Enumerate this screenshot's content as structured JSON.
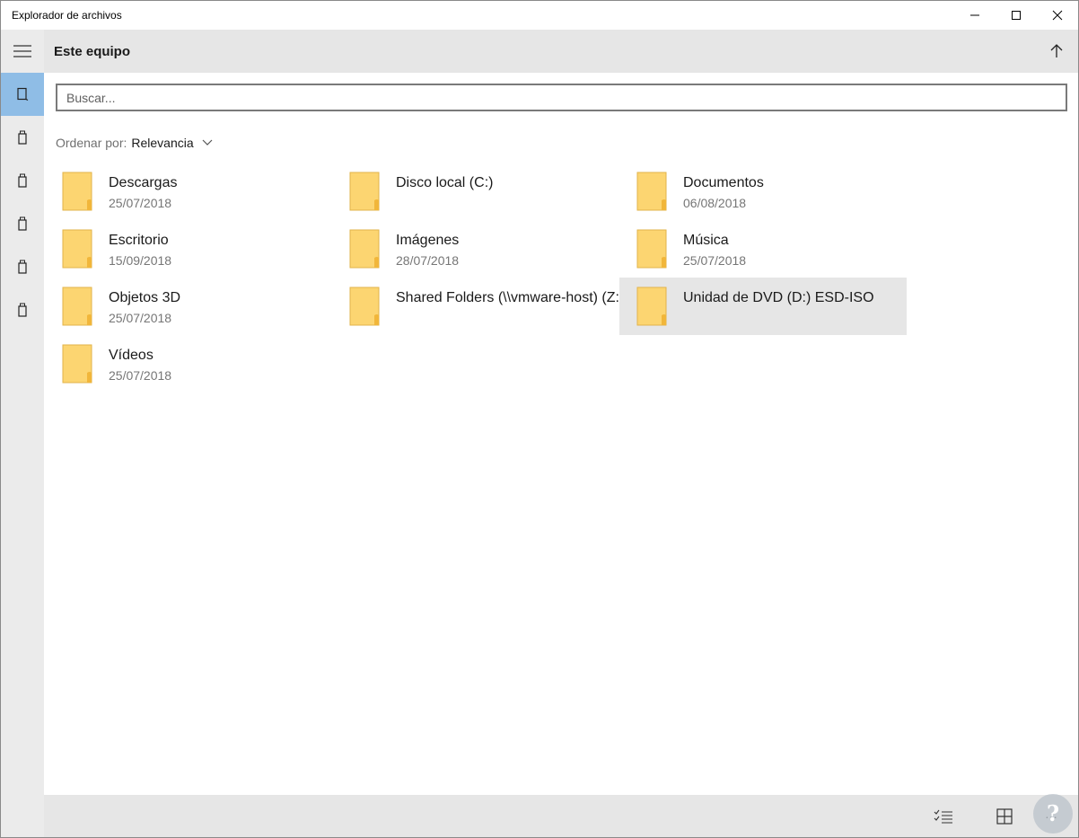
{
  "window": {
    "title": "Explorador de archivos"
  },
  "header": {
    "title": "Este equipo"
  },
  "search": {
    "placeholder": "Buscar..."
  },
  "sort": {
    "label": "Ordenar por:",
    "value": "Relevancia"
  },
  "sidebar": {
    "items": [
      {
        "icon": "tablet-device-icon",
        "active": true
      },
      {
        "icon": "usb-drive-icon"
      },
      {
        "icon": "usb-drive-icon"
      },
      {
        "icon": "usb-drive-icon"
      },
      {
        "icon": "usb-drive-icon"
      },
      {
        "icon": "usb-drive-icon"
      }
    ]
  },
  "items": [
    {
      "name": "Descargas",
      "date": "25/07/2018"
    },
    {
      "name": "Disco local (C:)",
      "date": ""
    },
    {
      "name": "Documentos",
      "date": "06/08/2018"
    },
    {
      "name": "Escritorio",
      "date": "15/09/2018"
    },
    {
      "name": "Imágenes",
      "date": "28/07/2018"
    },
    {
      "name": "Música",
      "date": "25/07/2018"
    },
    {
      "name": "Objetos 3D",
      "date": "25/07/2018"
    },
    {
      "name": "Shared Folders (\\\\vmware-host) (Z:)",
      "date": ""
    },
    {
      "name": "Unidad de DVD (D:) ESD-ISO",
      "date": "",
      "selected": true
    },
    {
      "name": "Vídeos",
      "date": "25/07/2018"
    }
  ],
  "bottombar": {
    "more_label": "···"
  },
  "colors": {
    "accent": "#8fbde6",
    "folder": "#fcd571",
    "folder_fold": "#f1b63a",
    "selected_bg": "#e6e6e6"
  }
}
